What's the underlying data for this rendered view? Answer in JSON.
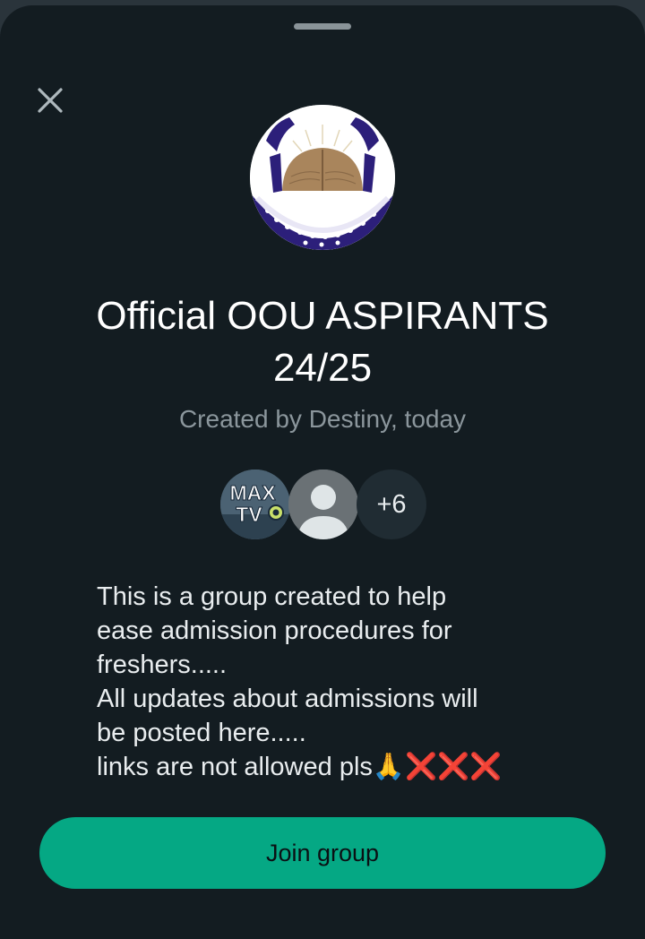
{
  "group": {
    "title_line1": "Official OOU ASPIRANTS",
    "title_line2": "24/25",
    "created_by": "Created by Destiny, today"
  },
  "members": {
    "first_avatar_text_top": "MAX",
    "first_avatar_text_bottom": "TV",
    "more_count": "+6"
  },
  "description": {
    "lines": [
      "This is a group created to help",
      "ease admission procedures for",
      "freshers.....",
      "All updates about admissions will",
      "be posted here.....",
      "links are not allowed pls🙏❌❌❌"
    ]
  },
  "actions": {
    "join_label": "Join group"
  },
  "icons": {
    "close": "close-icon",
    "default_avatar": "person-icon"
  },
  "colors": {
    "background": "#131c21",
    "accent": "#05a884",
    "text_primary": "#ffffff",
    "text_secondary": "#8b969c"
  }
}
